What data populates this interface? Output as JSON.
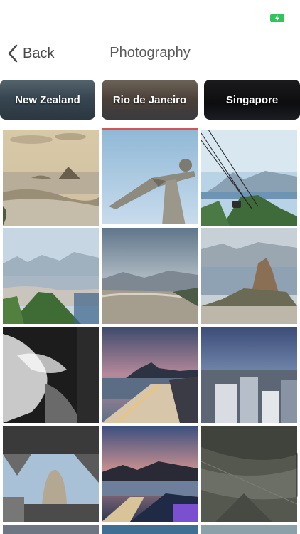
{
  "nav": {
    "back_label": "Back",
    "title": "Photography"
  },
  "tabs": [
    {
      "label": "New Zealand"
    },
    {
      "label": "Rio de Janeiro"
    },
    {
      "label": "Singapore"
    }
  ],
  "status": {
    "battery_color": "#2fc55a",
    "battery_icon": "battery-charging-icon"
  },
  "photos": [
    {
      "name": "sugarloaf-sepia-view"
    },
    {
      "name": "christ-the-redeemer-statue"
    },
    {
      "name": "cable-car-sugarloaf"
    },
    {
      "name": "city-from-hill"
    },
    {
      "name": "city-aerial-view"
    },
    {
      "name": "sugarloaf-mountain"
    },
    {
      "name": "black-white-dancer"
    },
    {
      "name": "copacabana-dusk"
    },
    {
      "name": "skyline-evening"
    },
    {
      "name": "cable-car-station"
    },
    {
      "name": "infinity-pool-dusk"
    },
    {
      "name": "rock-cliff"
    }
  ]
}
